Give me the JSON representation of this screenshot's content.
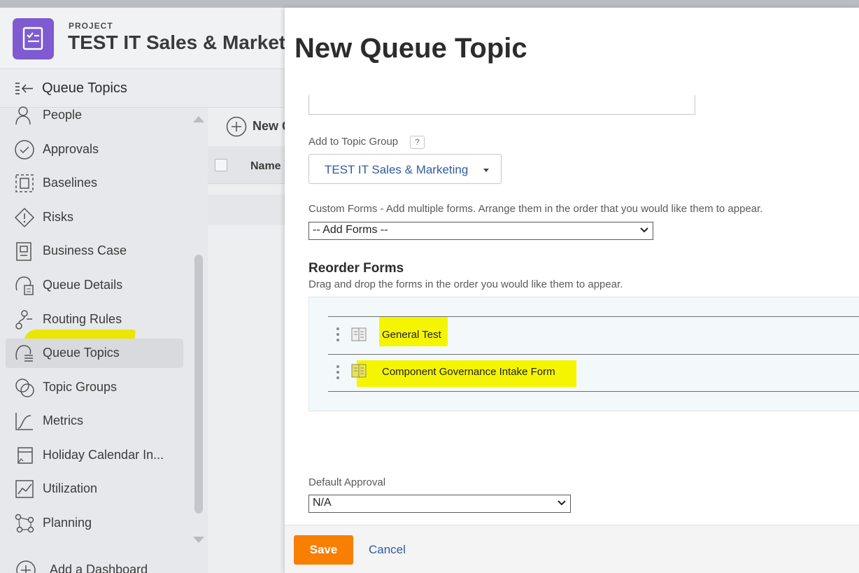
{
  "background": {
    "project_label": "PROJECT",
    "project_title": "TEST IT Sales & Market",
    "section_title": "Queue Topics",
    "sidebar_items": [
      {
        "label": "People",
        "icon": "people-icon"
      },
      {
        "label": "Approvals",
        "icon": "checkmark-circle-icon"
      },
      {
        "label": "Baselines",
        "icon": "baselines-icon"
      },
      {
        "label": "Risks",
        "icon": "risk-diamond-icon"
      },
      {
        "label": "Business Case",
        "icon": "business-case-icon"
      },
      {
        "label": "Queue Details",
        "icon": "queue-details-icon"
      },
      {
        "label": "Routing Rules",
        "icon": "routing-rules-icon"
      },
      {
        "label": "Queue Topics",
        "icon": "queue-topics-icon",
        "active": true
      },
      {
        "label": "Topic Groups",
        "icon": "topic-groups-icon"
      },
      {
        "label": "Metrics",
        "icon": "metrics-icon"
      },
      {
        "label": "Holiday Calendar In...",
        "icon": "holiday-calendar-icon"
      },
      {
        "label": "Utilization",
        "icon": "utilization-icon"
      },
      {
        "label": "Planning",
        "icon": "planning-icon"
      }
    ],
    "add_dashboard": "Add a Dashboard",
    "new_button_label": "New Q",
    "name_column": "Name"
  },
  "modal": {
    "title": "New Queue Topic",
    "topic_group_label": "Add to Topic Group",
    "help_label": "?",
    "topic_group_value": "TEST IT Sales & Marketing",
    "custom_forms_label": "Custom Forms - Add multiple forms. Arrange them in the order that you would like them to appear.",
    "add_forms_value": "-- Add Forms --",
    "reorder_title": "Reorder Forms",
    "reorder_subtitle": "Drag and drop the forms in the order you would like them to appear.",
    "forms": [
      {
        "name": "General Test"
      },
      {
        "name": "Component Governance Intake Form"
      }
    ],
    "default_approval_label": "Default Approval",
    "default_approval_value": "N/A",
    "save_label": "Save",
    "cancel_label": "Cancel"
  },
  "colors": {
    "accent_orange": "#f97f03",
    "link_blue": "#2f5c9e",
    "project_purple": "#7e5bd0",
    "highlight_yellow": "#f5f500"
  }
}
